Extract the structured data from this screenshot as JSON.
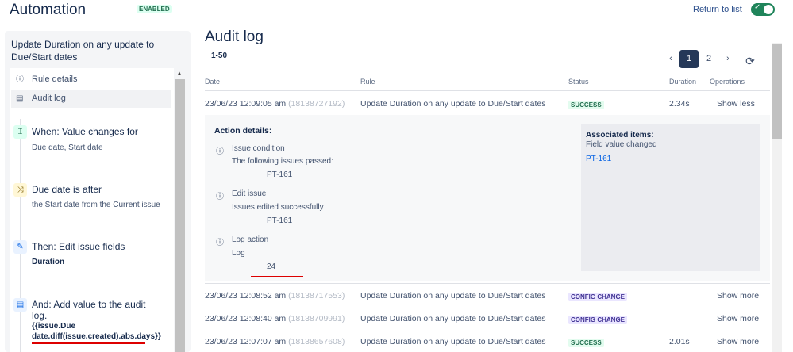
{
  "header": {
    "title": "Automation",
    "status_badge": "ENABLED",
    "return_link": "Return to list",
    "toggle_on": true
  },
  "sidebar": {
    "rule_name": "Update Duration on any update to Due/Start dates",
    "nav": [
      {
        "label": "Rule details",
        "icon": "info-icon"
      },
      {
        "label": "Audit log",
        "icon": "document-icon",
        "selected": true
      }
    ],
    "steps": [
      {
        "heading": "When: Value changes for",
        "detail": "Due date, Start date",
        "icon": "trigger-icon"
      },
      {
        "heading": "Due date is after",
        "detail": "the Start date from the Current issue",
        "icon": "condition-icon"
      },
      {
        "heading": "Then: Edit issue fields",
        "detail": "Duration",
        "icon": "pencil-icon"
      },
      {
        "heading": "And: Add value to the audit log.",
        "detail": "{{issue.Due date.diff(issue.created).abs.days}}",
        "icon": "log-icon"
      }
    ]
  },
  "main": {
    "title": "Audit log",
    "range": "1-50",
    "pagination": {
      "pages": [
        "1",
        "2"
      ],
      "current": "1"
    },
    "columns": [
      "Date",
      "Rule",
      "Status",
      "Duration",
      "Operations"
    ],
    "rows": [
      {
        "date": "23/06/23 12:09:05 am",
        "id": "(18138727192)",
        "rule": "Update Duration on any update to Due/Start dates",
        "status": "SUCCESS",
        "duration": "2.34s",
        "op": "Show less"
      },
      {
        "date": "23/06/23 12:08:52 am",
        "id": "(18138717553)",
        "rule": "Update Duration on any update to Due/Start dates",
        "status": "CONFIG CHANGE",
        "duration": "",
        "op": "Show more"
      },
      {
        "date": "23/06/23 12:08:40 am",
        "id": "(18138709991)",
        "rule": "Update Duration on any update to Due/Start dates",
        "status": "CONFIG CHANGE",
        "duration": "",
        "op": "Show more"
      },
      {
        "date": "23/06/23 12:07:07 am",
        "id": "(18138657608)",
        "rule": "Update Duration on any update to Due/Start dates",
        "status": "SUCCESS",
        "duration": "2.01s",
        "op": "Show more"
      }
    ],
    "details": {
      "title": "Action details:",
      "actions": [
        {
          "name": "Issue condition",
          "msg": "The following issues passed:",
          "value": "PT-161"
        },
        {
          "name": "Edit issue",
          "msg": "Issues edited successfully",
          "value": "PT-161"
        },
        {
          "name": "Log action",
          "msg": "Log",
          "value": "24"
        }
      ],
      "assoc_title": "Associated items:",
      "assoc_sub": "Field value changed",
      "assoc_link": "PT-161"
    }
  }
}
